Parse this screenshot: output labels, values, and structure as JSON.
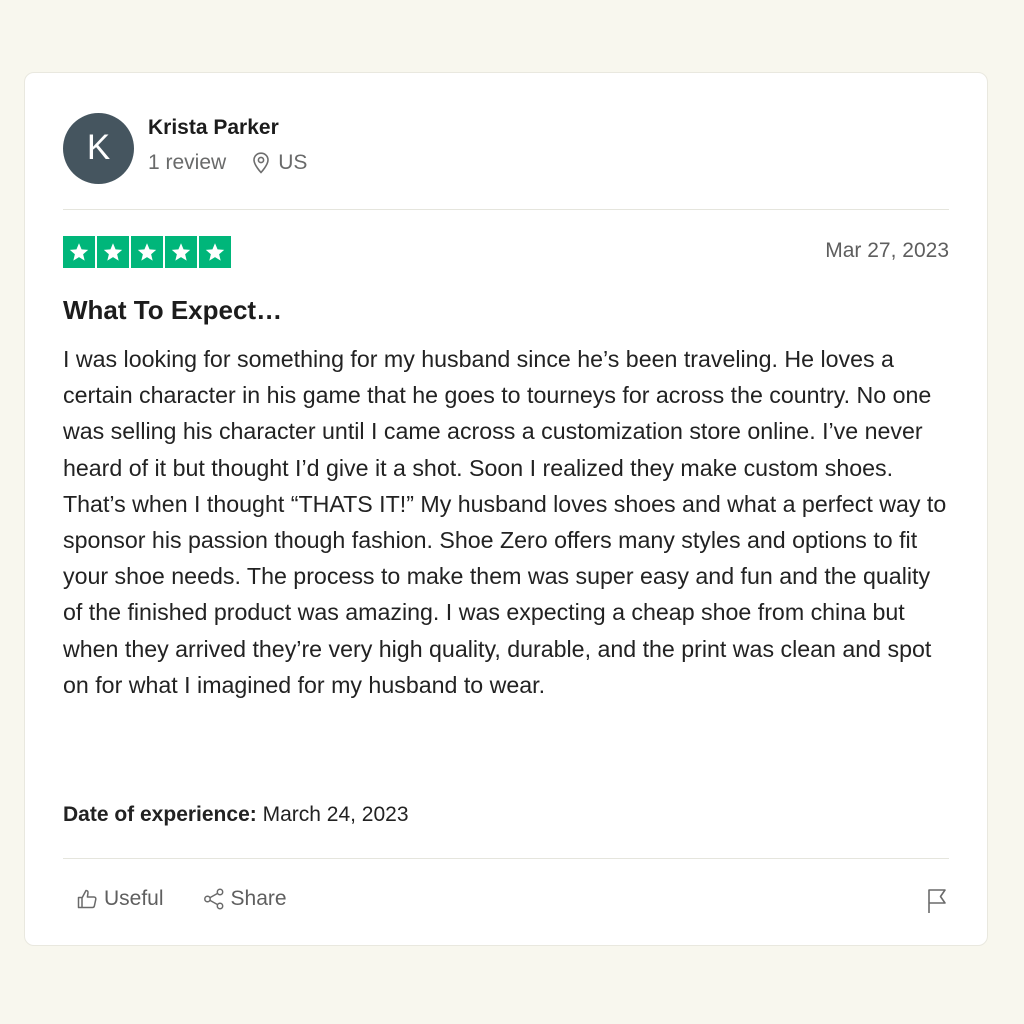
{
  "reviewer": {
    "initial": "K",
    "name": "Krista Parker",
    "review_count": "1 review",
    "location": "US",
    "avatar_color": "#45555f"
  },
  "review": {
    "rating": 5,
    "star_color": "#00b67a",
    "date": "Mar 27, 2023",
    "title": "What To Expect…",
    "body": "I was looking for something for my husband since he’s been traveling. He loves a certain character in his game that he goes to tourneys for across the country. No one was selling his character until I came across a customization store online. I’ve never heard of it but thought I’d give it a shot. Soon I realized they make custom shoes. That’s when I thought “THATS IT!” My husband loves shoes and what a perfect way to sponsor his passion though fashion. Shoe Zero offers many styles and options to fit your shoe needs. The process to make them was super easy and fun and the quality of the finished product was amazing. I was expecting a cheap shoe from china but when they arrived they’re very high quality, durable, and the print was clean and spot on for what I imagined for my husband to wear.",
    "experience_label": "Date of experience:",
    "experience_date": "March 24, 2023"
  },
  "actions": {
    "useful_label": "Useful",
    "share_label": "Share",
    "icons": [
      "thumbs-up-icon",
      "share-icon",
      "flag-icon",
      "location-pin-icon",
      "star-icon"
    ]
  }
}
